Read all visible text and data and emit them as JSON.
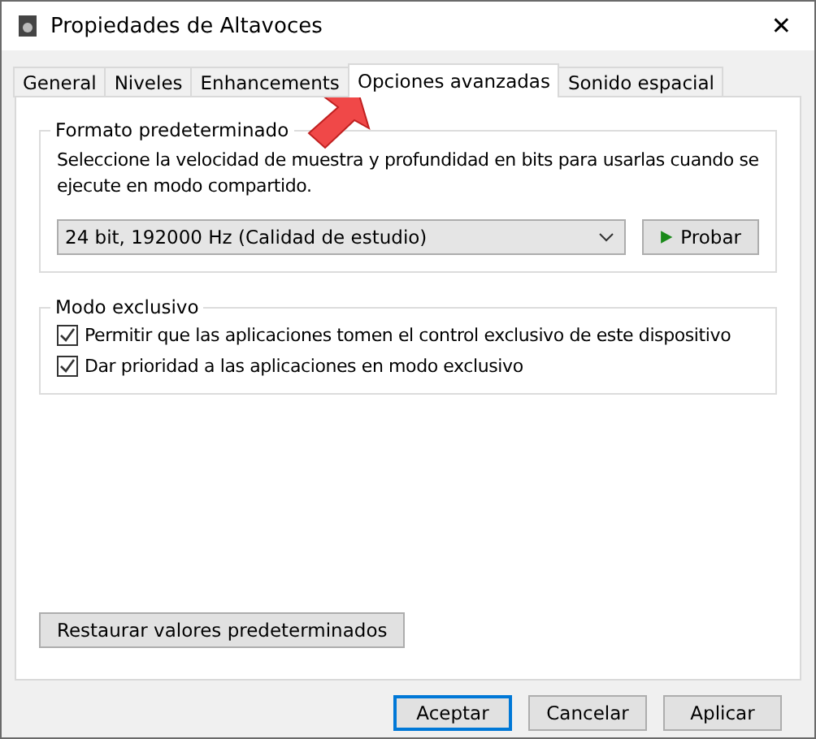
{
  "window": {
    "title": "Propiedades de Altavoces",
    "close": "✕"
  },
  "tabs": [
    {
      "label": "General",
      "selected": false
    },
    {
      "label": "Niveles",
      "selected": false
    },
    {
      "label": "Enhancements",
      "selected": false
    },
    {
      "label": "Opciones avanzadas",
      "selected": true
    },
    {
      "label": "Sonido espacial",
      "selected": false
    }
  ],
  "format_group": {
    "title": "Formato predeterminado",
    "description": "Seleccione la velocidad de muestra y profundidad en bits para usarlas cuando se ejecute en modo compartido.",
    "dropdown_value": "24 bit, 192000 Hz (Calidad de estudio)",
    "test_button": "Probar"
  },
  "exclusive_group": {
    "title": "Modo exclusivo",
    "options": [
      {
        "label": "Permitir que las aplicaciones tomen el control exclusivo de este dispositivo",
        "checked": true
      },
      {
        "label": "Dar prioridad a las aplicaciones en modo exclusivo",
        "checked": true
      }
    ]
  },
  "restore_button": "Restaurar valores predeterminados",
  "buttons": [
    {
      "label": "Aceptar",
      "default": true
    },
    {
      "label": "Cancelar",
      "default": false
    },
    {
      "label": "Aplicar",
      "default": false
    }
  ]
}
